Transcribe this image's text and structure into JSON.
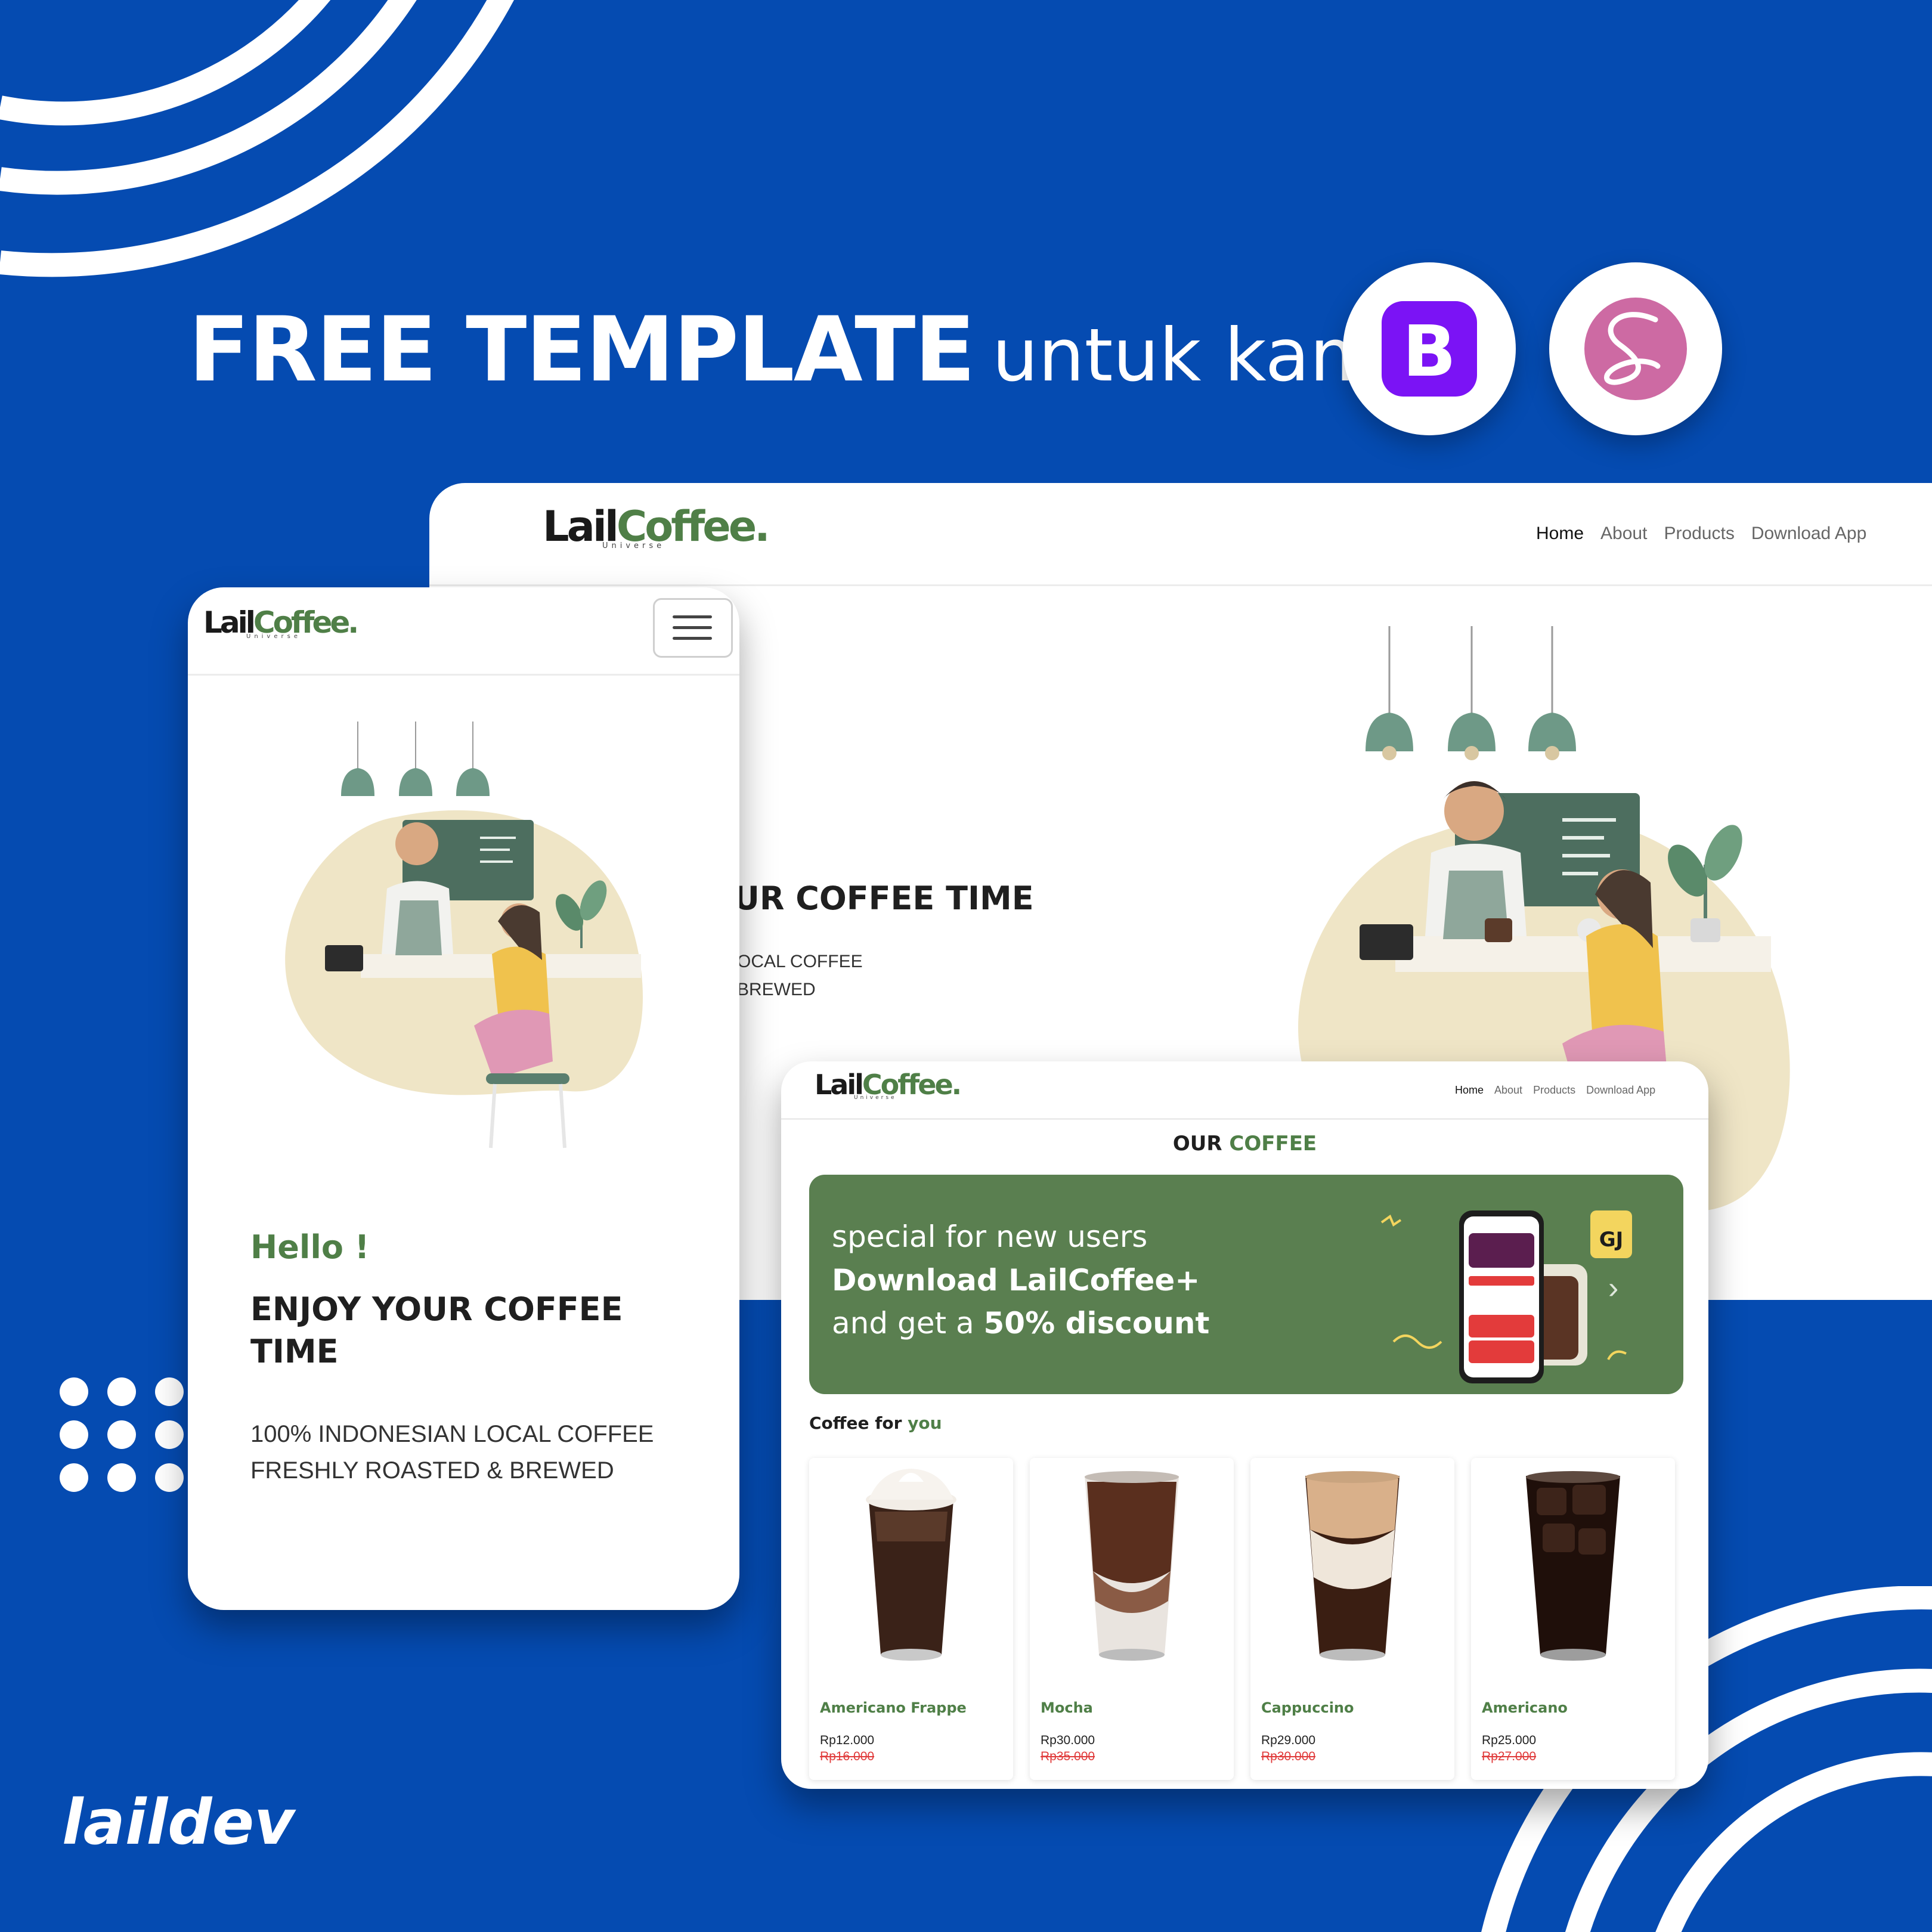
{
  "headline": {
    "bold": "FREE TEMPLATE",
    "light": "untuk kamu"
  },
  "badges": [
    {
      "letter": "B",
      "name": "bootstrap-logo",
      "color": "#7b13f5"
    },
    {
      "letter": "S",
      "name": "sass-logo",
      "color": "#cd6aa3"
    }
  ],
  "signature": "laildev",
  "brand": {
    "lail": "Lail",
    "coffee": "Coffee.",
    "sub": "Universe",
    "green": "#4f7f47"
  },
  "nav": {
    "home": "Home",
    "about": "About",
    "products": "Products",
    "download": "Download App"
  },
  "desktop_hero": {
    "title": "UR COFFEE TIME",
    "sub1": "OCAL COFFEE",
    "sub2": "BREWED"
  },
  "mobile_hero": {
    "hello": "Hello !",
    "title": "ENJOY YOUR COFFEE TIME",
    "sub1": "100% INDONESIAN LOCAL COFFEE",
    "sub2": "FRESHLY ROASTED & BREWED"
  },
  "products_page": {
    "section_title_a": "OUR",
    "section_title_b": "COFFEE",
    "banner": {
      "line1": "special for new users",
      "line2": "Download LailCoffee+",
      "line3_a": "and get a ",
      "line3_b": "50% discount"
    },
    "coffee_for_a": "Coffee for",
    "coffee_for_b": "you",
    "cards": [
      {
        "name": "Americano Frappe",
        "price": "Rp12.000",
        "old_price": "Rp16.000"
      },
      {
        "name": "Mocha",
        "price": "Rp30.000",
        "old_price": "Rp35.000"
      },
      {
        "name": "Cappuccino",
        "price": "Rp29.000",
        "old_price": "Rp30.000"
      },
      {
        "name": "Americano",
        "price": "Rp25.000",
        "old_price": "Rp27.000"
      }
    ]
  },
  "colors": {
    "background": "#054bb1",
    "green": "#4f7f47",
    "cream": "#efe5c6",
    "sale_red": "#e03a3a"
  }
}
